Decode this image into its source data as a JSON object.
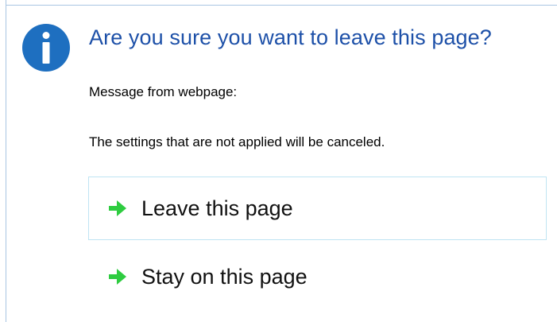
{
  "dialog": {
    "icon": "info-icon",
    "title": "Are you sure you want to leave this page?",
    "message_label": "Message from webpage:",
    "message_body": "The settings that are not applied will be canceled.",
    "options": [
      {
        "label": "Leave this page",
        "icon": "arrow-right-icon"
      },
      {
        "label": "Stay on this page",
        "icon": "arrow-right-icon"
      }
    ]
  },
  "colors": {
    "title": "#1d50a8",
    "icon": "#1e6fc0",
    "arrow": "#2ecc40",
    "focus_border": "#bfe4f3"
  }
}
